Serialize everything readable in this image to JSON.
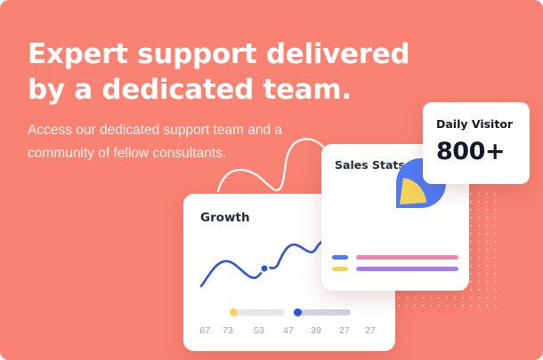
{
  "hero": {
    "headline_line1": "Expert support delivered",
    "headline_line2": "by a dedicated team.",
    "subtext": "Access our dedicated support team and a community of fellow consultants."
  },
  "growth_card": {
    "title": "Growth",
    "axis_labels": [
      "67",
      "73",
      "53",
      "47",
      "39",
      "27",
      "27"
    ],
    "colors": {
      "line": "#2d55d6",
      "marker": "#2d55d6"
    }
  },
  "sales_card": {
    "title": "Sales Stats",
    "pie": {
      "primary_color": "#4f7cf6",
      "accent_color": "#f5d35a"
    },
    "legend_colors": [
      "#4f7cf6",
      "#f5d35a"
    ],
    "bar_colors": [
      "#f284b4",
      "#a77cf0"
    ]
  },
  "visitor_card": {
    "label": "Daily Visitor",
    "value": "800+"
  },
  "theme": {
    "background": "#fa8272",
    "card": "#ffffff",
    "text_dark": "#111827"
  }
}
